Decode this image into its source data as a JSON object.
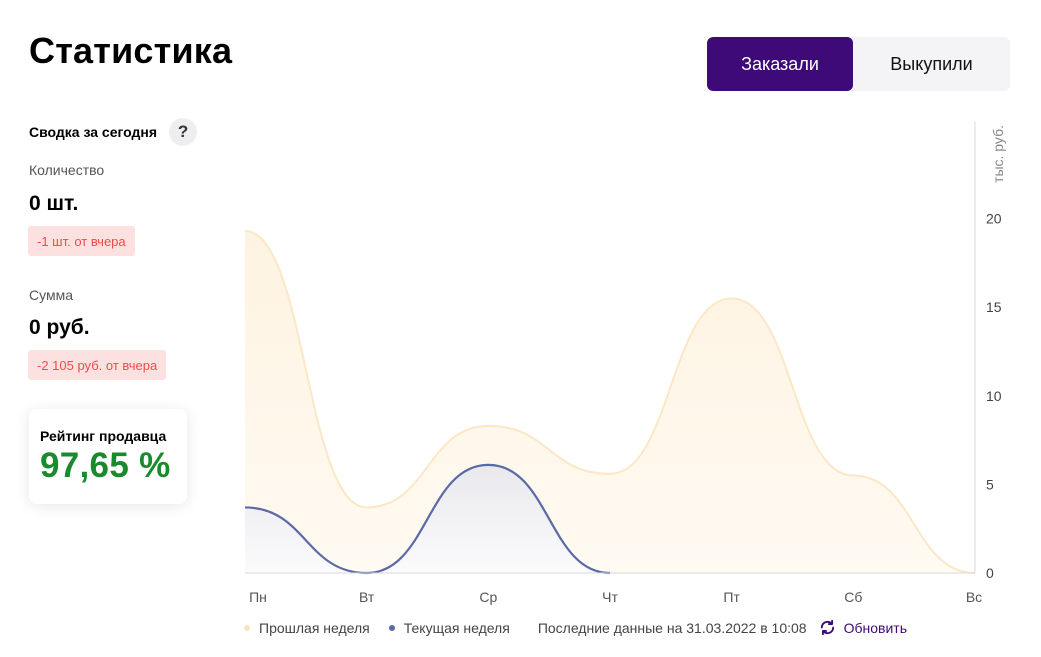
{
  "page": {
    "title": "Статистика"
  },
  "toggle": {
    "ordered_label": "Заказали",
    "bought_label": "Выкупили",
    "active_color": "#3d0a77"
  },
  "summary": {
    "heading": "Сводка за сегодня",
    "help_icon": "?",
    "quantity": {
      "label": "Количество",
      "value": "0 шт.",
      "delta": "-1 шт. от вчера"
    },
    "sum": {
      "label": "Сумма",
      "value": "0 руб.",
      "delta": "-2 105 руб. от вчера"
    }
  },
  "rating": {
    "label": "Рейтинг продавца",
    "value": "97,65 %",
    "color": "#1a8a2c"
  },
  "chart_data": {
    "type": "area",
    "categories": [
      "Пн",
      "Вт",
      "Ср",
      "Чт",
      "Пт",
      "Сб",
      "Вс"
    ],
    "unit_label": "тыс. руб.",
    "ylim": [
      0,
      25
    ],
    "yticks": [
      0,
      5,
      10,
      15,
      20
    ],
    "y_axis_position": "right",
    "grid": false,
    "legend_position": "bottom",
    "series": [
      {
        "name": "Прошлая неделя",
        "values": [
          19.3,
          3.7,
          8.3,
          5.6,
          15.5,
          5.5,
          0
        ],
        "color": "#fdf0d8",
        "dot_color": "#f8e4bd"
      },
      {
        "name": "Текущая неделя",
        "values": [
          3.7,
          0,
          6.1,
          0
        ],
        "color": "#5a6aa6",
        "dot_color": "#5a6aa6"
      }
    ]
  },
  "footer": {
    "updated": "Последние данные на 31.03.2022 в 10:08",
    "refresh_label": "Обновить",
    "refresh_icon": "refresh-icon"
  }
}
